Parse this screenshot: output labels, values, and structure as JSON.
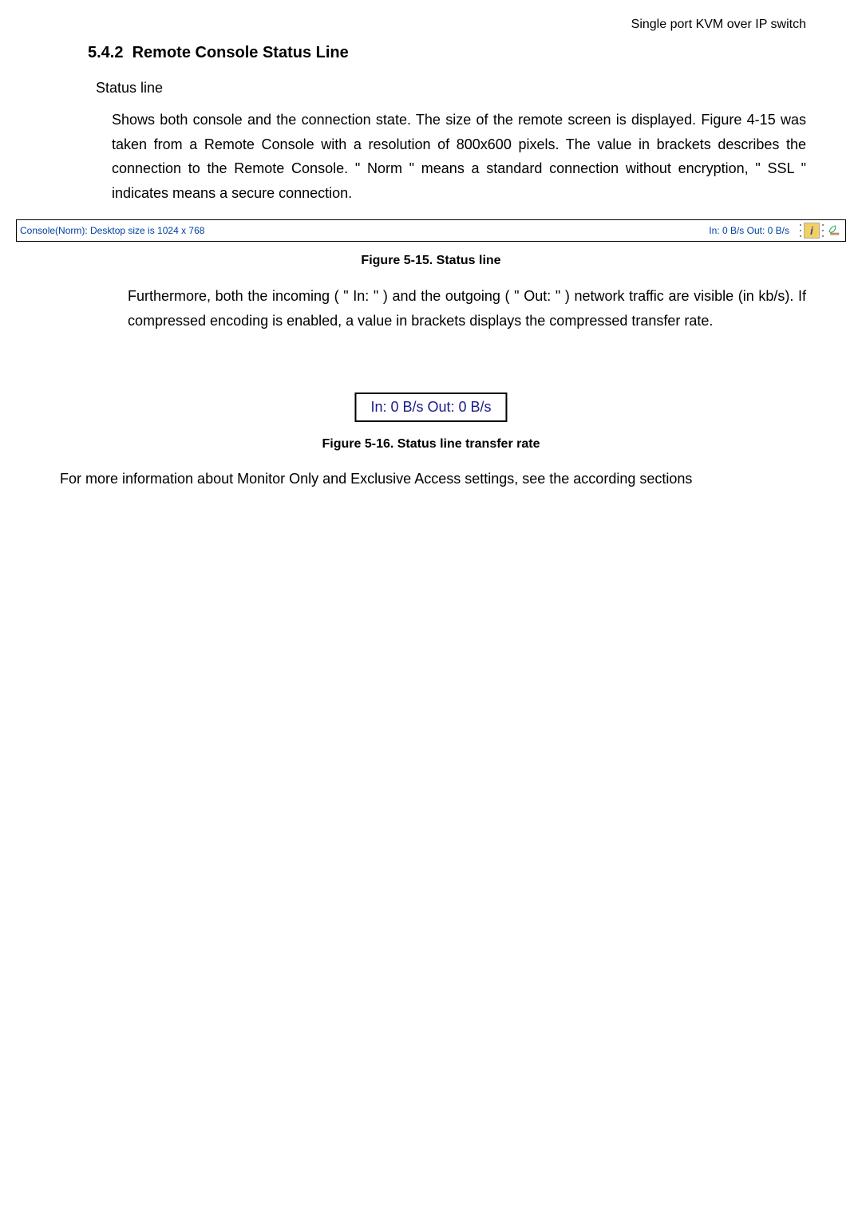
{
  "header": {
    "product": "Single port KVM over IP switch"
  },
  "section": {
    "number": "5.4.2",
    "title": "Remote Console Status Line"
  },
  "status_line_label": "Status line",
  "paragraph_1": "Shows both console and the connection state. The size of the remote screen is displayed. Figure 4-15 was taken from a Remote Console with a resolution of 800x600 pixels. The value in brackets describes the connection to the Remote Console. \" Norm \" means a standard connection without encryption, \" SSL \" indicates means a secure connection.",
  "status_bar": {
    "console_text": "Console(Norm): Desktop size is 1024 x 768",
    "traffic_text": "In: 0 B/s Out: 0 B/s",
    "info_icon_label": "i"
  },
  "caption_1": "Figure 5-15. Status line",
  "paragraph_2": "Furthermore, both the incoming ( \" In: \" ) and the outgoing ( \" Out: \" ) network traffic are visible (in kb/s). If compressed encoding is enabled, a value in brackets displays the compressed transfer rate.",
  "transfer_rate_box": "In: 0 B/s Out: 0 B/s",
  "caption_2": "Figure 5-16. Status line transfer rate",
  "final_paragraph": "For more information about Monitor Only and Exclusive Access settings, see the according sections"
}
